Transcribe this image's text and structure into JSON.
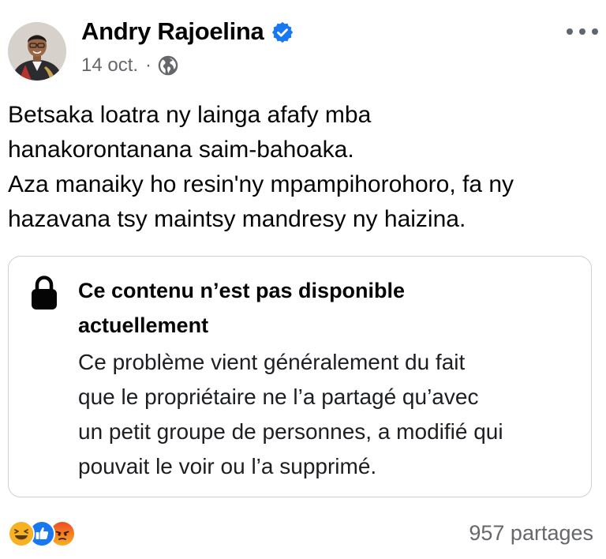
{
  "post": {
    "author": {
      "name": "Andry Rajoelina",
      "verified": true
    },
    "date": "14 oct.",
    "separator": "·",
    "audience_icon": "globe-icon",
    "text_lines": [
      "Betsaka loatra ny lainga afafy mba",
      "hanakorontanana saim-bahoaka.",
      "Aza manaiky ho resin'ny mpampihorohoro, fa ny",
      "hazavana tsy maintsy mandresy ny haizina."
    ]
  },
  "attachment": {
    "icon": "lock-icon",
    "title_lines": [
      "Ce contenu n’est pas disponible",
      "actuellement"
    ],
    "body_lines": [
      "Ce problème vient généralement du fait",
      "que le propriétaire ne l’a partagé qu’avec",
      "un petit groupe de personnes, a modifié qui",
      "pouvait le voir ou l’a supprimé."
    ]
  },
  "footer": {
    "reactions": [
      "haha-reaction-icon",
      "like-reaction-icon",
      "angry-reaction-icon"
    ],
    "shares": "957 partages"
  },
  "colors": {
    "verified_blue": "#1877f2",
    "secondary_text": "#65676b",
    "card_border": "#ced0d4",
    "like_blue": "#1877f2",
    "haha_yellow": "#f7b125",
    "angry_orange": "#e9710f"
  }
}
